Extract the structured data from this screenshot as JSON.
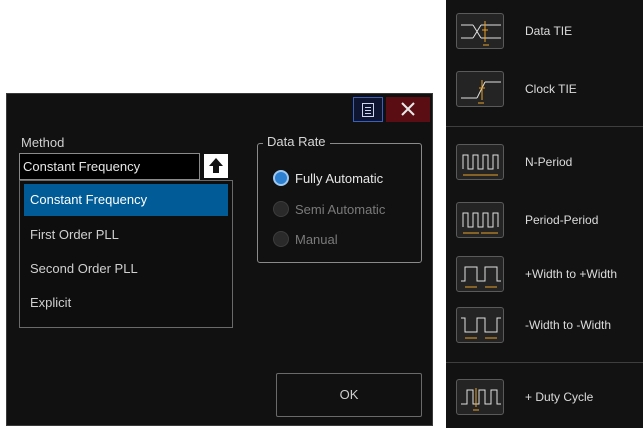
{
  "dialog": {
    "method_label": "Method",
    "method_value": "Constant Frequency",
    "method_options": [
      "Constant Frequency",
      "First Order PLL",
      "Second Order PLL",
      "Explicit"
    ],
    "data_rate": {
      "title": "Data Rate",
      "options": [
        {
          "label": "Fully Automatic",
          "selected": true
        },
        {
          "label": "Semi Automatic",
          "selected": false
        },
        {
          "label": "Manual",
          "selected": false
        }
      ]
    },
    "ok_label": "OK"
  },
  "measure_panel": {
    "items": [
      {
        "label": "Data TIE",
        "icon": "data-tie-icon"
      },
      {
        "label": "Clock TIE",
        "icon": "clock-tie-icon"
      },
      {
        "label": "N-Period",
        "icon": "n-period-icon"
      },
      {
        "label": "Period-Period",
        "icon": "period-period-icon"
      },
      {
        "label": "+Width to +Width",
        "icon": "pos-width-icon"
      },
      {
        "label": "-Width to -Width",
        "icon": "neg-width-icon"
      },
      {
        "label": "+ Duty Cycle",
        "icon": "duty-cycle-icon"
      }
    ]
  },
  "colors": {
    "accent": "#005b96",
    "radio_on": "#2d7fd0",
    "close": "#5a0e14",
    "icon_marker": "#e8a028"
  }
}
